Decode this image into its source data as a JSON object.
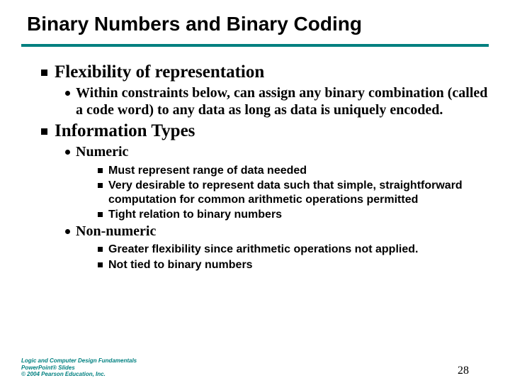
{
  "title": "Binary Numbers and Binary Coding",
  "b1": {
    "head": "Flexibility of representation",
    "sub1": "Within constraints below, can assign any binary combination (called a code word) to any data as long as data is uniquely encoded."
  },
  "b2": {
    "head": "Information Types",
    "numeric": {
      "label": "Numeric",
      "i1": "Must represent range of data needed",
      "i2": "Very desirable to represent data such that simple, straightforward computation for common arithmetic operations permitted",
      "i3": "Tight relation to binary numbers"
    },
    "nonnumeric": {
      "label": "Non-numeric",
      "i1": "Greater flexibility since arithmetic operations not applied.",
      "i2": "Not tied to binary numbers"
    }
  },
  "footer": {
    "line1": "Logic and Computer Design Fundamentals",
    "line2": "PowerPoint® Slides",
    "line3": "© 2004 Pearson Education, Inc."
  },
  "page": "28"
}
